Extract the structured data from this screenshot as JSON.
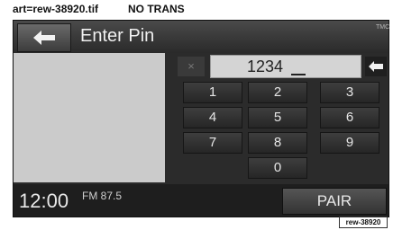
{
  "caption": {
    "art": "art=rew-38920.tif",
    "trans": "NO TRANS"
  },
  "header": {
    "title": "Enter Pin",
    "corner_label": "TMC"
  },
  "pin": {
    "value": "1234",
    "clear_label": "×"
  },
  "keypad": {
    "keys": [
      "1",
      "2",
      "3",
      "4",
      "5",
      "6",
      "7",
      "8",
      "9",
      "0"
    ]
  },
  "footer": {
    "clock": "12:00",
    "radio": "FM 87.5",
    "pair_label": "PAIR"
  },
  "figure_tag": "rew-38920",
  "colors": {
    "screen_bg": "#2b2b2b",
    "panel_bg": "#cbcbcb",
    "text": "#e6e6e6"
  }
}
